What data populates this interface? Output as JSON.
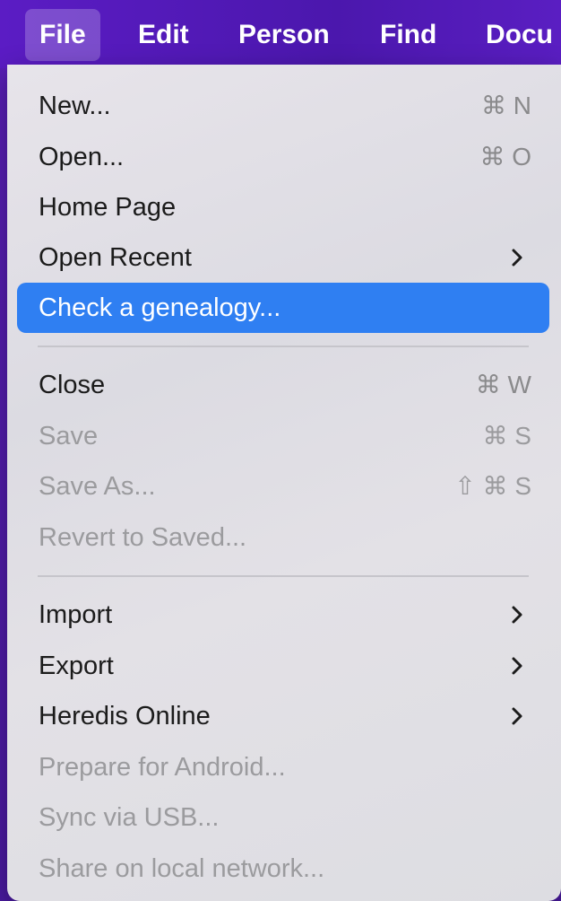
{
  "menubar": {
    "items": [
      "File",
      "Edit",
      "Person",
      "Find",
      "Docu"
    ]
  },
  "menu": {
    "items": [
      {
        "label": "New...",
        "shortcut": "⌘ N"
      },
      {
        "label": "Open...",
        "shortcut": "⌘ O"
      },
      {
        "label": "Home Page"
      },
      {
        "label": "Open Recent",
        "submenu": true
      },
      {
        "label": "Check a genealogy...",
        "highlighted": true
      },
      {
        "label": "Close",
        "shortcut": "⌘ W"
      },
      {
        "label": "Save",
        "shortcut": "⌘ S",
        "disabled": true
      },
      {
        "label": "Save As...",
        "shortcut": "⇧ ⌘ S",
        "disabled": true
      },
      {
        "label": "Revert to Saved...",
        "disabled": true
      },
      {
        "label": "Import",
        "submenu": true
      },
      {
        "label": "Export",
        "submenu": true
      },
      {
        "label": "Heredis Online",
        "submenu": true
      },
      {
        "label": "Prepare for Android...",
        "disabled": true
      },
      {
        "label": "Sync via USB...",
        "disabled": true
      },
      {
        "label": "Share on local network...",
        "disabled": true
      }
    ]
  },
  "colors": {
    "accent": "#2f7ff2",
    "menubar": "#5b1cc4"
  }
}
